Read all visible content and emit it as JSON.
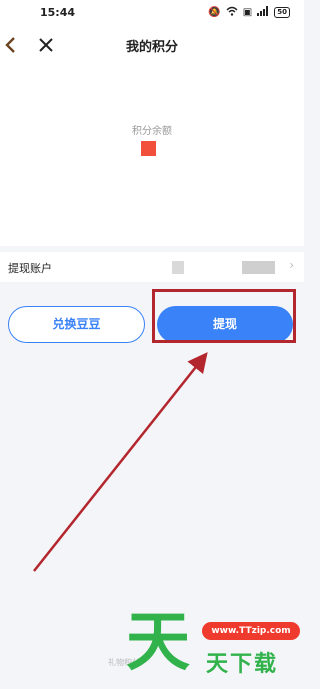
{
  "status_bar": {
    "time": "15:44",
    "icons": [
      "mute-icon",
      "wifi-icon",
      "hd-icon",
      "signal-icon",
      "battery-icon"
    ],
    "battery_level": "50"
  },
  "nav": {
    "title": "我的积分",
    "back_icon": "chevron-left-icon",
    "close_icon": "close-icon"
  },
  "balance": {
    "label": "积分余额",
    "value_color": "#f2503a"
  },
  "withdraw_account": {
    "label": "提现账户",
    "chevron": "›"
  },
  "buttons": {
    "exchange_label": "兑换豆豆",
    "withdraw_label": "提现"
  },
  "footer": {
    "note": "礼物积分"
  },
  "watermark": {
    "big_char": "天",
    "url": "www.TTzip.com",
    "name": "天下载"
  },
  "colors": {
    "accent": "#3a82f7",
    "highlight": "#b3262d",
    "watermark_green": "#31b24b",
    "watermark_red": "#ef3b2d"
  }
}
